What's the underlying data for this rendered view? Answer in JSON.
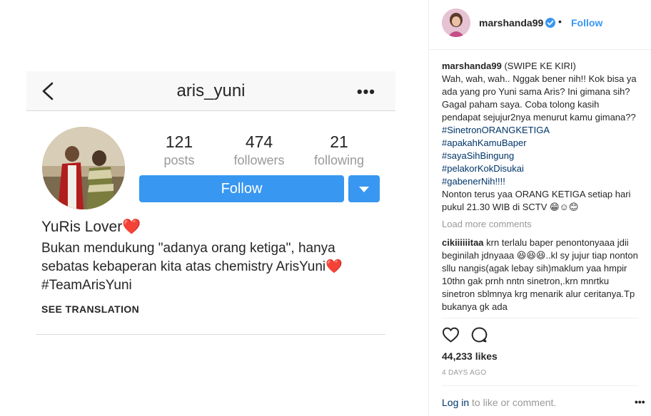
{
  "media": {
    "profile_username": "aris_yuni",
    "stats": [
      {
        "count": "121",
        "label": "posts"
      },
      {
        "count": "474",
        "label": "followers"
      },
      {
        "count": "21",
        "label": "following"
      }
    ],
    "follow_label": "Follow",
    "bio_name": "YuRis Lover❤️",
    "bio_text": "Bukan mendukung \"adanya orang ketiga\", hanya sebatas kebaperan kita atas chemistry ArisYuni❤️ #TeamArisYuni",
    "see_translation": "SEE TRANSLATION"
  },
  "header": {
    "username": "marshanda99",
    "separator": "•",
    "follow_label": "Follow"
  },
  "caption": {
    "username": "marshanda99",
    "text_lines": [
      "(SWIPE KE KIRI)",
      "Wah, wah, wah.. Nggak bener nih!! Kok bisa ya ada yang pro Yuni sama Aris? Ini gimana sih? Gagal paham saya. Coba tolong kasih pendapat sejujur2nya menurut kamu gimana??"
    ],
    "hashtags": [
      "#SinetronORANGKETIGA",
      "#apakahKamuBaper",
      "#sayaSihBingung",
      "#pelakorKokDisukai",
      "#gabenerNih!!!!"
    ],
    "closing": "Nonton terus yaa ORANG KETIGA setiap hari pukul 21.30 WIB di SCTV 😁☺😊"
  },
  "load_more": "Load more comments",
  "comment": {
    "username": "cikiiiiiitaa",
    "text": "krn terlalu baper penontonyaaa jdii beginilah jdnyaaa 😆😆😆..kl sy jujur tiap nonton sllu nangis(agak lebay sih)maklum yaa hmpir 10thn gak prnh nntn sinetron,.krn mnrtku sinetron sblmnya krg menarik alur ceritanya.Tp bukanya gk ada"
  },
  "likes": "44,233 likes",
  "time_ago": "4 DAYS AGO",
  "login": {
    "link": "Log in",
    "rest": " to like or comment.",
    "options": "•••"
  },
  "colors": {
    "accent": "#3897f0",
    "link": "#003569",
    "muted": "#999999"
  }
}
